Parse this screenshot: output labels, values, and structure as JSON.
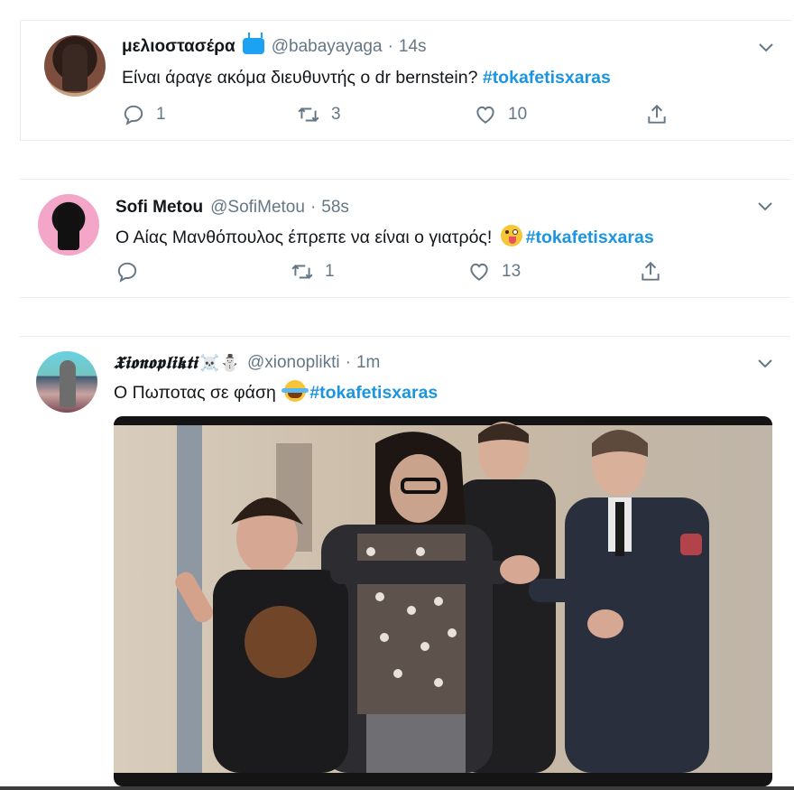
{
  "tweets": [
    {
      "name": "μελιοστασέρα",
      "badge_icon": "tv-icon",
      "handle": "@babayayaga",
      "separator": "·",
      "time": "14s",
      "text": "Είναι άραγε ακόμα διευθυντής ο dr bernstein?",
      "emoji": "",
      "hashtag": "#tokafetisxaras",
      "replies": "1",
      "retweets": "3",
      "likes": "10"
    },
    {
      "name": "Sofi Metou",
      "handle": "@SofiMetou",
      "separator": "·",
      "time": "58s",
      "text": "Ο Αίας Μανθόπουλος έπρεπε να είναι ο γιατρός!",
      "emoji": "tongue-wink-emoji",
      "hashtag": "#tokafetisxaras",
      "replies": "",
      "retweets": "1",
      "likes": "13"
    },
    {
      "name": "𝖃𝖎𝖔𝖓𝖔𝖕𝖑𝖎𝖐𝖙𝖎",
      "name_decor": "☠️⛄",
      "handle": "@xionoplikti",
      "separator": "·",
      "time": "1m",
      "text": "Ο Πωποτας σε φάση",
      "emoji": "joy-emoji",
      "hashtag": "#tokafetisxaras",
      "media_icon": "photo-media"
    }
  ],
  "colors": {
    "hashtag": "#1b95e0",
    "muted": "#657786",
    "border": "#e6ecf0"
  },
  "icons": [
    "reply-icon",
    "retweet-icon",
    "like-icon",
    "share-icon",
    "chevron-down-icon"
  ]
}
